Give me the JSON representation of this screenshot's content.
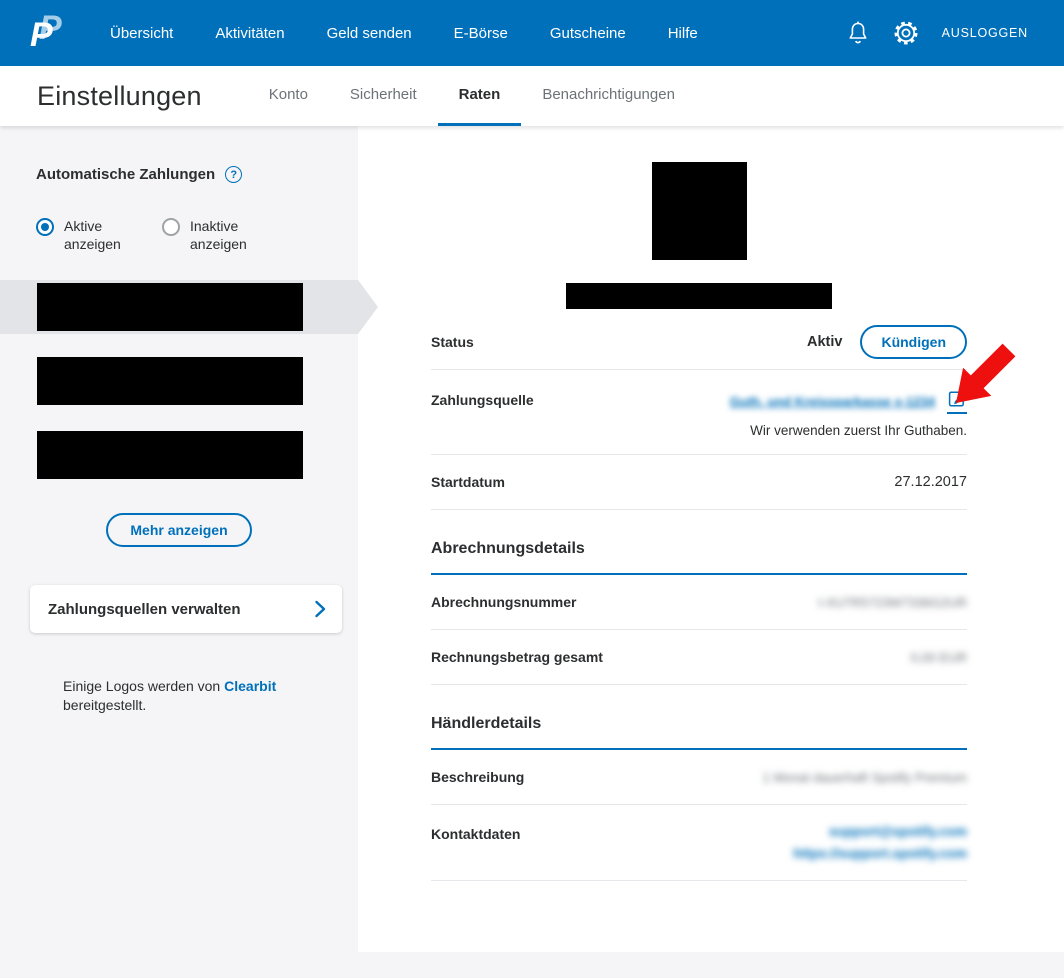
{
  "nav": {
    "brand": "PayPal",
    "items": [
      "Übersicht",
      "Aktivitäten",
      "Geld senden",
      "E-Börse",
      "Gutscheine",
      "Hilfe"
    ],
    "logout": "AUSLOGGEN"
  },
  "header": {
    "title": "Einstellungen",
    "tabs": [
      "Konto",
      "Sicherheit",
      "Raten",
      "Benachrichtigungen"
    ],
    "active_tab": "Raten"
  },
  "sidebar": {
    "section_title": "Automatische Zahlungen",
    "help_icon": "?",
    "radio_active_label": "Aktive anzeigen",
    "radio_inactive_label": "Inaktive anzeigen",
    "more_button": "Mehr anzeigen",
    "manage_card_label": "Zahlungsquellen verwalten",
    "logos_note_prefix": "Einige Logos werden von",
    "logos_link": "Clearbit",
    "logos_note_suffix": "bereitgestellt."
  },
  "main": {
    "status_label": "Status",
    "status_value": "Aktiv",
    "cancel_button": "Kündigen",
    "payment_source_label": "Zahlungsquelle",
    "payment_source_value": "Guth. und Kreissparkasse x-1234",
    "payment_source_note": "Wir verwenden zuerst Ihr Guthaben.",
    "start_date_label": "Startdatum",
    "start_date_value": "27.12.2017",
    "billing_section_title": "Abrechnungsdetails",
    "billing_number_label": "Abrechnungsnummer",
    "billing_number_value": "I-XU7R5723W7336G2UR",
    "billing_total_label": "Rechnungsbetrag gesamt",
    "billing_total_value": "0,00 EUR",
    "merchant_section_title": "Händlerdetails",
    "description_label": "Beschreibung",
    "description_value": "1 Monat dauerhaft Spotify Premium",
    "contact_label": "Kontaktdaten",
    "contact_email": "support@spotify.com",
    "contact_url": "https://support.spotify.com"
  },
  "colors": {
    "brand_blue": "#0070ba",
    "annotation_red": "#ee0f0f"
  }
}
